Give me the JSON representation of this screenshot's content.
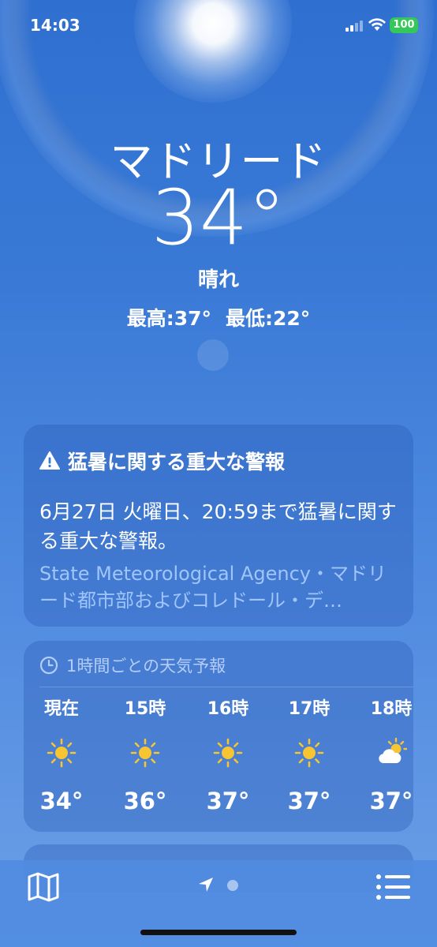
{
  "status_bar": {
    "time": "14:03",
    "battery": "100"
  },
  "location": {
    "city": "マドリード",
    "temperature": "34°",
    "condition": "晴れ",
    "high": "最高:37°",
    "low": "最低:22°"
  },
  "alert": {
    "title": "猛暑に関する重大な警報",
    "body": "6月27日 火曜日、20:59まで猛暑に関する重大な警報。",
    "source": "State Meteorological Agency・マドリード都市部およびコレドール・デ…"
  },
  "hourly": {
    "title": "1時間ごとの天気予報",
    "items": [
      {
        "label": "現在",
        "icon": "sun-icon",
        "temp": "34°"
      },
      {
        "label": "15時",
        "icon": "sun-icon",
        "temp": "36°"
      },
      {
        "label": "16時",
        "icon": "sun-icon",
        "temp": "37°"
      },
      {
        "label": "17時",
        "icon": "sun-icon",
        "temp": "37°"
      },
      {
        "label": "18時",
        "icon": "partly-cloudy-icon",
        "temp": "37°"
      }
    ]
  },
  "colors": {
    "sun": "#f7c531",
    "battery": "#34c759",
    "alert_source": "#aacdff"
  }
}
